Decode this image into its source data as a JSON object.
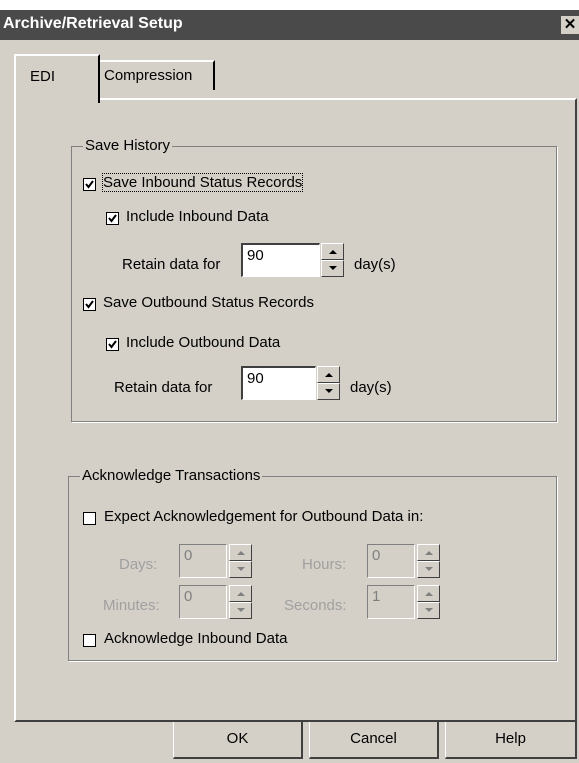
{
  "window": {
    "title": "Archive/Retrieval Setup",
    "close_glyph": "✕"
  },
  "tabs": [
    {
      "label": "EDI",
      "active": true
    },
    {
      "label": "Compression",
      "active": false
    }
  ],
  "save_history": {
    "legend": "Save History",
    "inbound": {
      "label": "Save Inbound Status Records",
      "checked": true,
      "include_label": "Include Inbound Data",
      "include_checked": true,
      "retain_label": "Retain data for",
      "retain_value": "90",
      "unit": "day(s)"
    },
    "outbound": {
      "label": "Save Outbound Status Records",
      "checked": true,
      "include_label": "Include Outbound Data",
      "include_checked": true,
      "retain_label": "Retain data for",
      "retain_value": "90",
      "unit": "day(s)"
    }
  },
  "acknowledge": {
    "legend": "Acknowledge Transactions",
    "expect_label": "Expect Acknowledgement for Outbound Data in:",
    "expect_checked": false,
    "days_label": "Days:",
    "days_value": "0",
    "hours_label": "Hours:",
    "hours_value": "0",
    "minutes_label": "Minutes:",
    "minutes_value": "0",
    "seconds_label": "Seconds:",
    "seconds_value": "1",
    "ack_inbound_label": "Acknowledge Inbound Data",
    "ack_inbound_checked": false
  },
  "buttons": {
    "ok": "OK",
    "cancel": "Cancel",
    "help": "Help"
  }
}
